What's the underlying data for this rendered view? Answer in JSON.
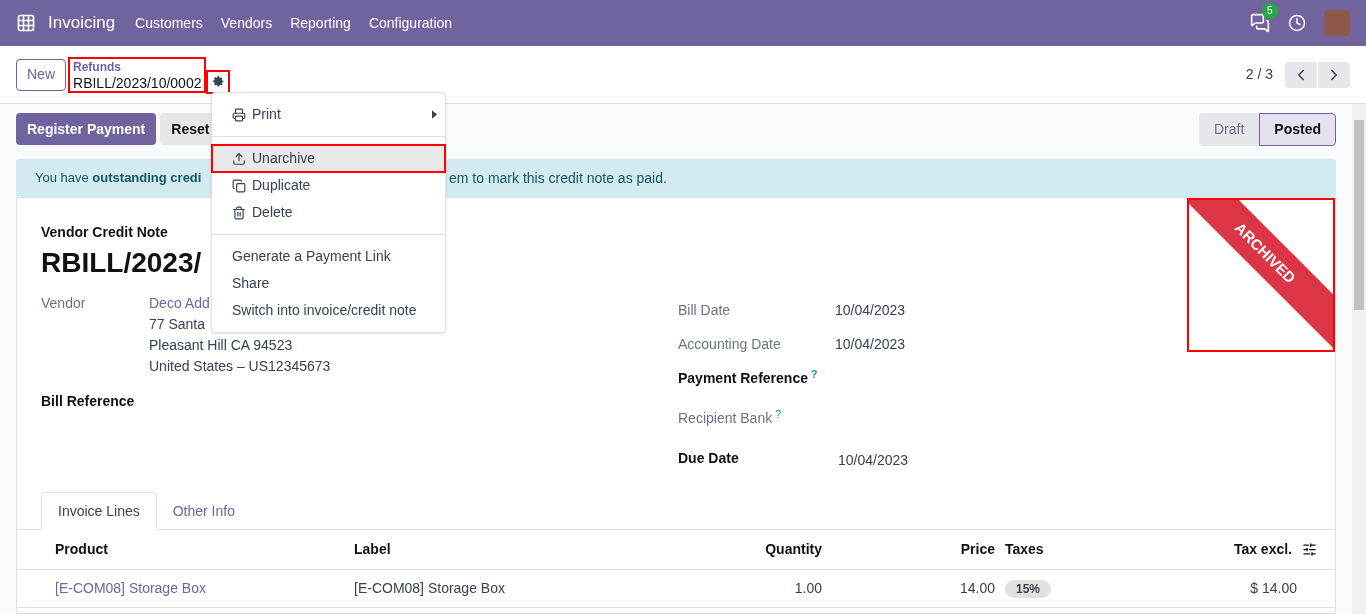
{
  "navbar": {
    "app": "Invoicing",
    "menu": [
      "Customers",
      "Vendors",
      "Reporting",
      "Configuration"
    ],
    "messages_count": "5"
  },
  "control_panel": {
    "new_button": "New",
    "breadcrumb": {
      "parent": "Refunds",
      "current": "RBILL/2023/10/0002",
      "highlighted": true
    },
    "gear_highlighted": true,
    "pager": "2 / 3"
  },
  "actions": {
    "register_payment": "Register Payment",
    "reset": "Reset"
  },
  "status_steps": [
    {
      "label": "Draft",
      "selected": false
    },
    {
      "label": "Posted",
      "selected": true
    }
  ],
  "banner": {
    "before": "You have **outstanding credi**",
    "after": "em to mark this credit note as paid."
  },
  "action_menu": [
    {
      "kind": "item",
      "label": "Print",
      "submenu": true,
      "highlighted": false
    },
    {
      "kind": "divider"
    },
    {
      "kind": "item",
      "label": "Unarchive",
      "submenu": false,
      "highlighted": true
    },
    {
      "kind": "item",
      "label": "Duplicate",
      "submenu": false,
      "highlighted": false
    },
    {
      "kind": "item",
      "label": "Delete",
      "submenu": false,
      "highlighted": false
    },
    {
      "kind": "divider"
    },
    {
      "kind": "item",
      "label": "Generate a Payment Link",
      "submenu": false,
      "highlighted": false
    },
    {
      "kind": "item",
      "label": "Share",
      "submenu": false,
      "highlighted": false
    },
    {
      "kind": "item",
      "label": "Switch into invoice/credit note",
      "submenu": false,
      "highlighted": false
    }
  ],
  "sheet": {
    "doc_type": "Vendor Credit Note",
    "title": "RBILL/2023/",
    "ribbon": {
      "label": "ARCHIVED",
      "highlighted": true
    },
    "vendor": {
      "label": "Vendor",
      "name": "Deco Add",
      "address": [
        "77 Santa",
        "Pleasant Hill CA 94523",
        "United States – US12345673"
      ]
    },
    "bill_reference": "Bill Reference",
    "right_fields": [
      {
        "label": "Bill Date",
        "value": "10/04/2023",
        "bold": false,
        "help": false
      },
      {
        "label": "Accounting Date",
        "value": "10/04/2023",
        "bold": false,
        "help": false
      },
      {
        "label": "Payment Reference",
        "bold": true,
        "help": true
      },
      {
        "label": "Recipient Bank",
        "bold": false,
        "help": true
      },
      {
        "label": "Due Date",
        "value": "10/04/2023",
        "bold": true,
        "help": false
      }
    ],
    "help_mark": "?"
  },
  "tabs": [
    {
      "label": "Invoice Lines",
      "selected": true
    },
    {
      "label": "Other Info",
      "selected": false
    }
  ],
  "table": {
    "columns": [
      "Product",
      "Label",
      "Quantity",
      "Price",
      "Taxes",
      "Tax excl."
    ],
    "rows": [
      {
        "product": "[E-COM08] Storage Box",
        "label": "[E-COM08] Storage Box",
        "quantity": "1.00",
        "price": "14.00",
        "taxes": "15%",
        "tax_excl": "$ 14.00"
      }
    ]
  }
}
